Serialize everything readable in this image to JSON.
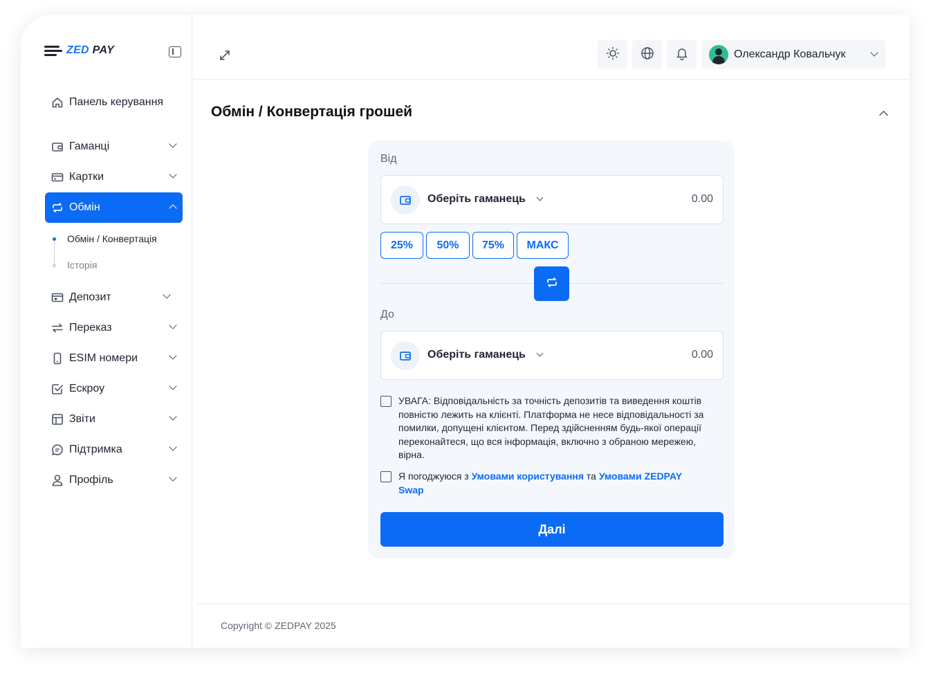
{
  "brand": {
    "logo_text_a": "ZED",
    "logo_text_b": "PAY"
  },
  "sidebar": {
    "items": [
      {
        "label": "Панель керування",
        "icon": "home-icon"
      },
      {
        "label": "Гаманці",
        "icon": "wallet-icon"
      },
      {
        "label": "Картки",
        "icon": "card-icon"
      },
      {
        "label": "Обмін",
        "icon": "exchange-icon"
      },
      {
        "label": "Депозит",
        "icon": "deposit-icon"
      },
      {
        "label": "Переказ",
        "icon": "transfer-icon"
      },
      {
        "label": "ESIM номери",
        "icon": "phone-icon"
      },
      {
        "label": "Ескроу",
        "icon": "check-square-icon"
      },
      {
        "label": "Звіти",
        "icon": "table-icon"
      },
      {
        "label": "Підтримка",
        "icon": "chat-icon"
      },
      {
        "label": "Профіль",
        "icon": "user-icon"
      }
    ],
    "sub_items": [
      "Обмін / Конвертація",
      "Історія"
    ]
  },
  "topbar": {
    "user_name": "Олександр Ковальчук"
  },
  "page": {
    "title": "Обмін / Конвертація грошей"
  },
  "exchange": {
    "from_label": "Від",
    "to_label": "До",
    "wallet_placeholder": "Оберіть гаманець",
    "from_amount": "0.00",
    "to_amount": "0.00",
    "percent_buttons": [
      "25%",
      "50%",
      "75%",
      "МАКС"
    ],
    "warning_text": "УВАГА: Відповідальність за точність депозитів та виведення коштів повністю лежить на клієнті. Платформа не несе відповідальності за помилки, допущені клієнтом. Перед здійсненням будь-якої операції переконайтеся, що вся інформація, включно з обраною мережею, вірна.",
    "agree_prefix": "Я погоджуюся з",
    "agree_link1": "Умовами користування",
    "agree_mid": "та",
    "agree_link2": "Умовами ZEDPAY Swap",
    "next_label": "Далі"
  },
  "footer": {
    "copyright": "Copyright © ZEDPAY 2025"
  },
  "colors": {
    "accent": "#0b6bf5",
    "text": "#1f2430",
    "muted": "#5f6673"
  }
}
